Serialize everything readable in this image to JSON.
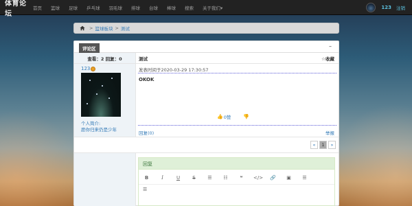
{
  "navbar": {
    "brand": "体育论坛",
    "items": [
      "首页",
      "篮球",
      "足球",
      "乒乓球",
      "羽毛球",
      "排球",
      "台球",
      "棒球",
      "搜索",
      "关于我们▾"
    ],
    "user": "123",
    "logout": "注销"
  },
  "breadcrumb": {
    "section": "篮球板块",
    "current": "测试",
    "separator": ">"
  },
  "panel": {
    "title": "评论区",
    "minimize": "–"
  },
  "thread": {
    "stats": "查看：2  回复：0",
    "title": "测试",
    "favorite": "☆收藏"
  },
  "post": {
    "author": "123",
    "profile_label": "个人简介:",
    "signature": "愿你归来仍是少年",
    "time": "发表时间于2020-03-29 17:30:57",
    "body": "OKOK",
    "likes": "0赞",
    "reply_count": "回复(0)",
    "report": "举报"
  },
  "pagination": {
    "prev": "«",
    "current": "1",
    "next": "»"
  },
  "reply": {
    "title": "回复",
    "toolbar": [
      "B",
      "I",
      "U",
      "S",
      "☰",
      "☷",
      "❝",
      "</>",
      "🔗",
      "▣",
      "☰",
      "☰"
    ]
  },
  "colors": {
    "navbar_bg": "#222222",
    "link": "#337ab7",
    "reply_header_bg": "#dff0d8",
    "accent_user": "#5bc0de"
  }
}
